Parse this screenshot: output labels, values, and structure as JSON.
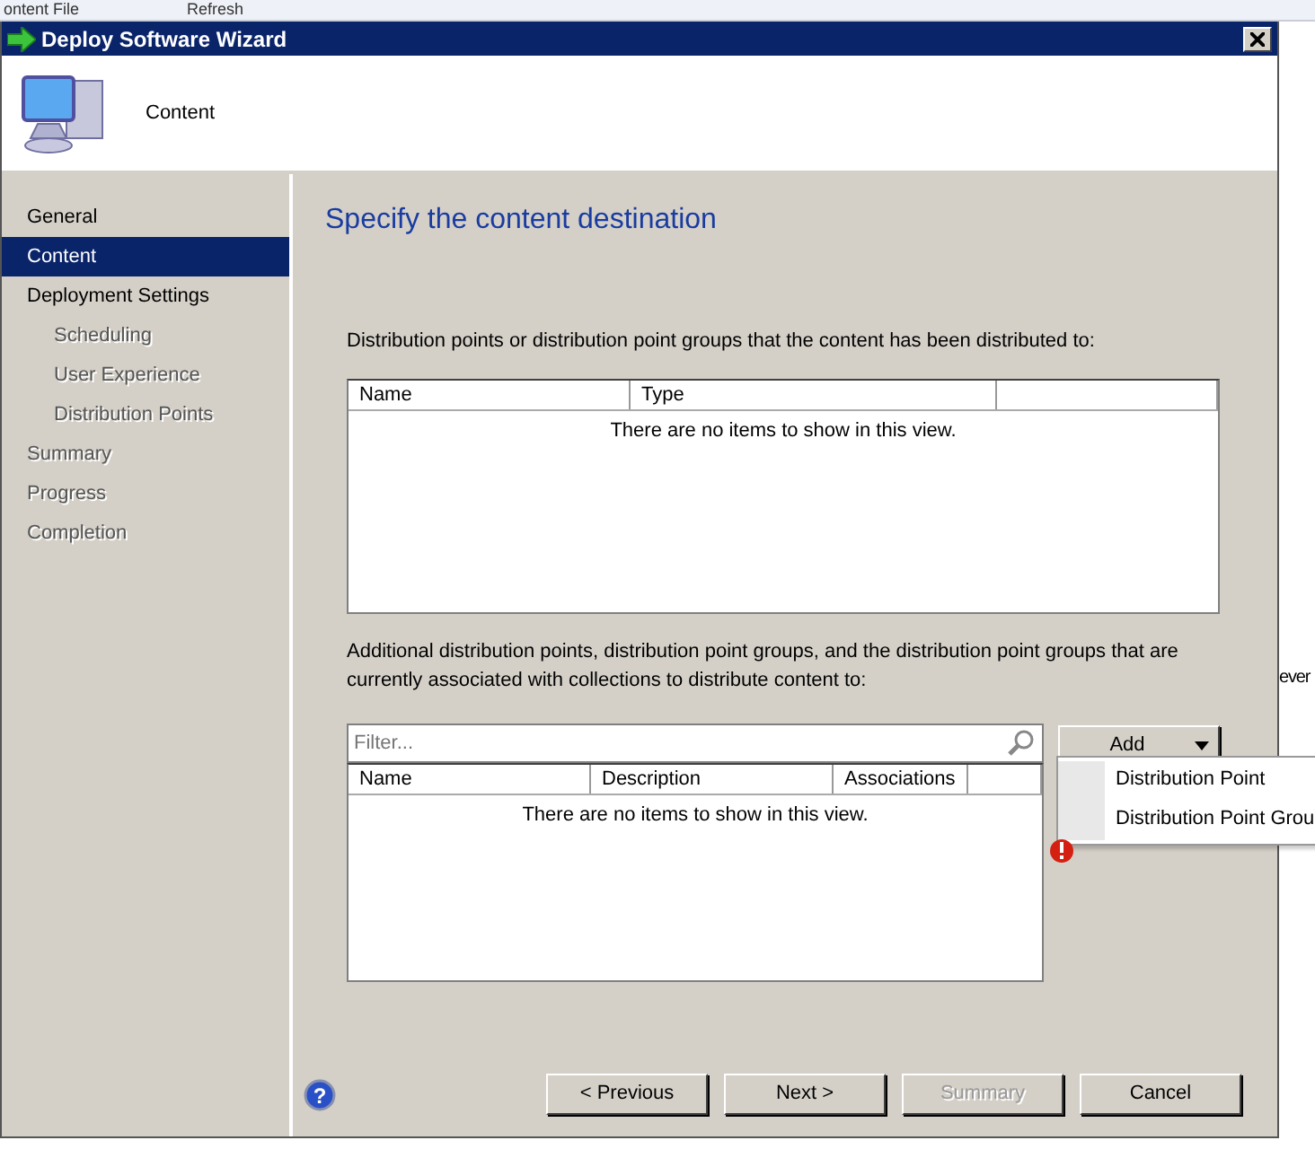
{
  "background": {
    "toolbar": [
      "ontent File",
      "Refresh"
    ],
    "side_text": "ever"
  },
  "window": {
    "title": "Deploy Software Wizard"
  },
  "header": {
    "title": "Content"
  },
  "nav": [
    {
      "label": "General",
      "selected": false,
      "disabled": false
    },
    {
      "label": "Content",
      "selected": true,
      "disabled": false
    },
    {
      "label": "Deployment Settings",
      "selected": false,
      "disabled": false,
      "children": [
        {
          "label": "Scheduling",
          "selected": false,
          "disabled": true
        },
        {
          "label": "User Experience",
          "selected": false,
          "disabled": true
        },
        {
          "label": "Distribution Points",
          "selected": false,
          "disabled": true
        }
      ]
    },
    {
      "label": "Summary",
      "selected": false,
      "disabled": true
    },
    {
      "label": "Progress",
      "selected": false,
      "disabled": true
    },
    {
      "label": "Completion",
      "selected": false,
      "disabled": true
    }
  ],
  "page": {
    "heading": "Specify the content destination",
    "distributed": {
      "label": "Distribution points or distribution point groups that the content has been distributed to:",
      "columns": [
        "Name",
        "Type"
      ],
      "empty_text": "There are no items to show in this view."
    },
    "additional": {
      "label": "Additional distribution points, distribution point groups, and the distribution point groups that are currently associated with collections to distribute content to:",
      "filter": {
        "placeholder": "Filter..."
      },
      "columns": [
        "Name",
        "Description",
        "Associations"
      ],
      "empty_text": "There are no items to show in this view."
    },
    "add_button": {
      "label": "Add",
      "expanded": true
    },
    "menu": [
      "Distribution Point",
      "Distribution Point Grou"
    ]
  },
  "footer": {
    "help_glyph": "?",
    "buttons": [
      {
        "label": "< Previous",
        "disabled": false
      },
      {
        "label": "Next >",
        "disabled": false
      },
      {
        "label": "Summary",
        "disabled": true
      },
      {
        "label": "Cancel",
        "disabled": false
      }
    ]
  }
}
